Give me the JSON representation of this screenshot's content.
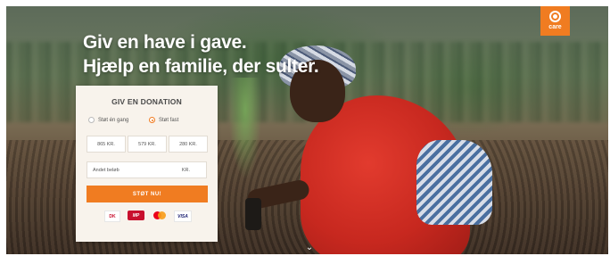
{
  "hero": {
    "headline_line1": "Giv en have i gave.",
    "headline_line2": "Hjælp en familie, der sulter."
  },
  "logo": {
    "text": "care",
    "color": "#f07c21"
  },
  "donation": {
    "title": "GIV EN DONATION",
    "frequency": [
      {
        "label": "Støt én gang",
        "selected": false
      },
      {
        "label": "Støt fast",
        "selected": true
      }
    ],
    "amounts": [
      "865 KR.",
      "579 KR.",
      "280 KR."
    ],
    "other_amount": {
      "label": "Andet beløb",
      "currency": "KR."
    },
    "cta_label": "STØT NU!",
    "accent": "#f07c21"
  },
  "payment_icons": [
    "dankort-icon",
    "mobilepay-icon",
    "mastercard-icon",
    "visa-icon"
  ],
  "payment_labels": {
    "dankort": "DK",
    "mobilepay": "MP",
    "visa": "VISA"
  },
  "scroll_hint": "⌄"
}
